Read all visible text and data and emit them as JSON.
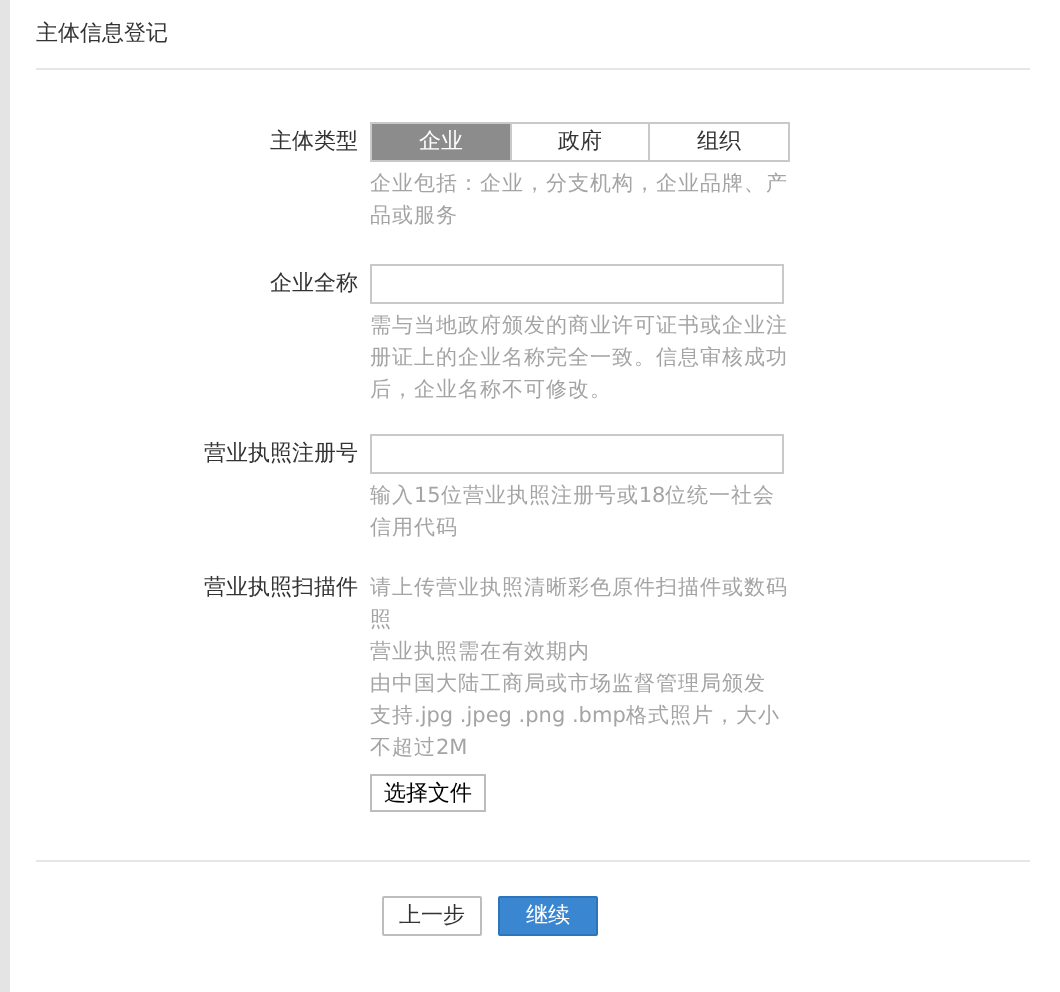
{
  "title": "主体信息登记",
  "type_selector": {
    "label": "主体类型",
    "options": [
      {
        "label": "企业",
        "selected": true
      },
      {
        "label": "政府",
        "selected": false
      },
      {
        "label": "组织",
        "selected": false
      }
    ],
    "hint": "企业包括：企业，分支机构，企业品牌、产品或服务"
  },
  "fields": [
    {
      "label": "企业全称",
      "hint": "需与当地政府颁发的商业许可证书或企业注册证上的企业名称完全一致。信息审核成功后，企业名称不可修改。"
    },
    {
      "label": "营业执照注册号",
      "hint": "输入15位营业执照注册号或18位统一社会信用代码"
    }
  ],
  "upload": {
    "label": "营业执照扫描件",
    "hints": [
      "请上传营业执照清晰彩色原件扫描件或数码照",
      "营业执照需在有效期内",
      "由中国大陆工商局或市场监督管理局颁发",
      "支持.jpg .jpeg .png .bmp格式照片，大小不超过2M"
    ],
    "button": "选择文件"
  },
  "actions": [
    {
      "label": "上一步",
      "kind": "secondary"
    },
    {
      "label": "继续",
      "kind": "primary"
    }
  ]
}
